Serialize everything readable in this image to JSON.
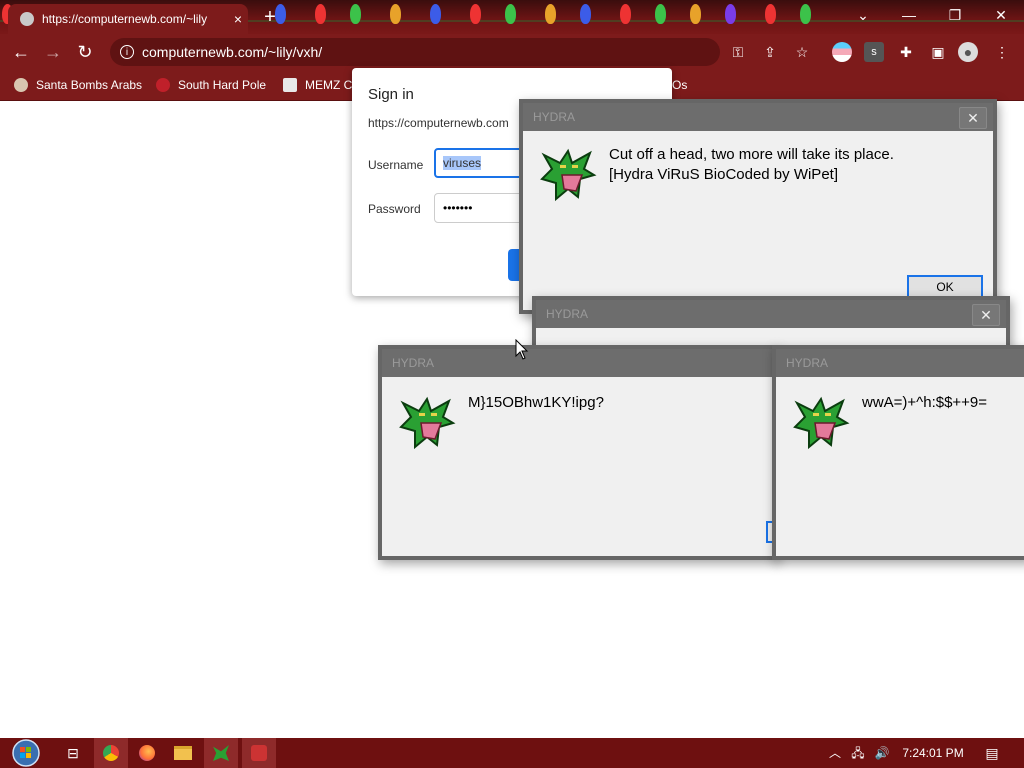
{
  "browser": {
    "tab_title": "https://computernewb.com/~lily",
    "tab_close": "×",
    "new_tab": "+",
    "address": "computernewb.com/~lily/vxh/",
    "bookmarks": [
      {
        "label": "Santa Bombs Arabs"
      },
      {
        "label": "South Hard Pole"
      },
      {
        "label": "MEMZ C"
      },
      {
        "label": "Os"
      }
    ],
    "window_controls": {
      "tabsearch": "⌄",
      "minimize": "—",
      "restore": "❐",
      "close": "✕"
    },
    "nav": {
      "back": "←",
      "forward": "→",
      "reload": "↻"
    }
  },
  "signin": {
    "title": "Sign in",
    "origin": "https://computernewb.com",
    "username_label": "Username",
    "username_value": "viruses",
    "password_label": "Password",
    "password_value": "•••••••"
  },
  "hydra": {
    "windows": [
      {
        "title": "HYDRA",
        "line1": "Cut off a head, two more will take its place.",
        "line2": "[Hydra ViRuS BioCoded by WiPet]",
        "ok": "OK",
        "close": "✕"
      },
      {
        "title": "HYDRA",
        "close": "✕"
      },
      {
        "title": "HYDRA",
        "line1": "M}15OBhw1KY!ipg?"
      },
      {
        "title": "HYDRA",
        "line1": "wwA=)+^h:$$++9="
      }
    ]
  },
  "taskbar": {
    "clock": "7:24:01 PM"
  },
  "colors": {
    "chrome": "#7d1b1b",
    "taskbar": "#6e1010",
    "accent": "#1a73e8"
  }
}
